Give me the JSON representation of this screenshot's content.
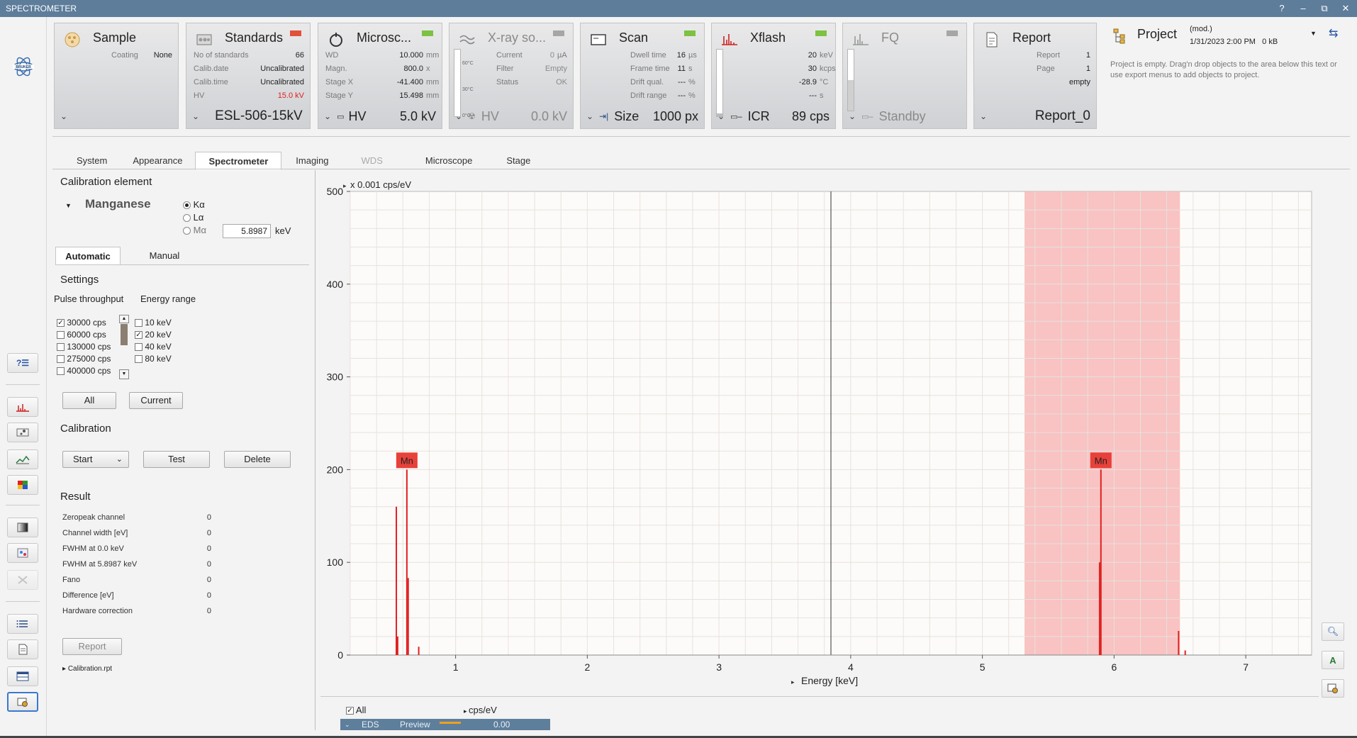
{
  "window": {
    "title": "SPECTROMETER",
    "controls": [
      "?",
      "–",
      "⧉",
      "✕"
    ]
  },
  "tiles": {
    "sample": {
      "name": "Sample",
      "rows": [
        {
          "k": "Coating",
          "v": "None",
          "u": ""
        }
      ]
    },
    "standards": {
      "name": "Standards",
      "rows": [
        {
          "k": "No of standards",
          "v": "66",
          "u": ""
        },
        {
          "k": "Calib.date",
          "v": "Uncalibrated",
          "u": ""
        },
        {
          "k": "Calib.time",
          "v": "Uncalibrated",
          "u": ""
        },
        {
          "k": "HV",
          "v": "15.0 kV",
          "u": ""
        }
      ],
      "footer": "ESL-506-15kV",
      "indicator": "#e0523a",
      "hv_color": "#e02020"
    },
    "microscope": {
      "name": "Microsc...",
      "rows": [
        {
          "k": "WD",
          "v": "10.000",
          "u": "mm"
        },
        {
          "k": "Magn.",
          "v": "800.0",
          "u": "x"
        },
        {
          "k": "Stage X",
          "v": "-41.400",
          "u": "mm"
        },
        {
          "k": "Stage Y",
          "v": "15.498",
          "u": "mm"
        }
      ],
      "footer_label": "HV",
      "footer_value": "5.0 kV",
      "indicator": "#7dc242"
    },
    "xray": {
      "name": "X-ray so...",
      "rows": [
        {
          "k": "Current",
          "v": "0",
          "u": "µA"
        },
        {
          "k": "Filter",
          "v": "Empty",
          "u": ""
        },
        {
          "k": "Status",
          "v": "OK",
          "u": ""
        }
      ],
      "scale": [
        "60°C",
        "30°C",
        "0°C"
      ],
      "footer_label": "HV",
      "footer_value": "0.0 kV",
      "indicator": "#a6a6a6"
    },
    "scan": {
      "name": "Scan",
      "rows": [
        {
          "k": "Dwell time",
          "v": "16",
          "u": "µs"
        },
        {
          "k": "Frame time",
          "v": "11",
          "u": "s"
        },
        {
          "k": "Drift qual.",
          "v": "---",
          "u": "%"
        },
        {
          "k": "Drift range",
          "v": "---",
          "u": "%"
        }
      ],
      "footer_label": "Size",
      "footer_value": "1000 px",
      "indicator": "#7dc242"
    },
    "xflash": {
      "name": "Xflash",
      "rows": [
        {
          "k": "",
          "v": "20",
          "u": "keV"
        },
        {
          "k": "",
          "v": "30",
          "u": "kcps"
        },
        {
          "k": "",
          "v": "-28.9",
          "u": "°C"
        },
        {
          "k": "",
          "v": "---",
          "u": "s"
        }
      ],
      "footer_label": "ICR",
      "footer_value": "89 cps",
      "indicator": "#7dc242"
    },
    "fq": {
      "name": "FQ",
      "footer_label": "Standby",
      "indicator": "#a6a6a6"
    },
    "report": {
      "name": "Report",
      "rows": [
        {
          "k": "Report",
          "v": "1",
          "u": ""
        },
        {
          "k": "Page",
          "v": "1",
          "u": ""
        },
        {
          "k": "",
          "v": "empty",
          "u": ""
        }
      ],
      "footer": "Report_0"
    }
  },
  "project": {
    "title": "Project",
    "status": "(mod.)",
    "datetime": "1/31/2023 2:00 PM",
    "size": "0 kB",
    "description": "Project is empty. Drag'n drop objects to the area below this text or use export menus to add objects to project."
  },
  "tabs": [
    {
      "label": "System",
      "active": false,
      "enabled": true
    },
    {
      "label": "Appearance",
      "active": false,
      "enabled": true
    },
    {
      "label": "Spectrometer",
      "active": true,
      "enabled": true
    },
    {
      "label": "Imaging",
      "active": false,
      "enabled": true
    },
    {
      "label": "WDS",
      "active": false,
      "enabled": false
    },
    {
      "label": "Microscope",
      "active": false,
      "enabled": true
    },
    {
      "label": "Stage",
      "active": false,
      "enabled": true
    }
  ],
  "calibration_element": {
    "title": "Calibration element",
    "element": "Manganese",
    "lines": [
      {
        "label": "Kα",
        "selected": true
      },
      {
        "label": "Lα",
        "selected": false
      },
      {
        "label": "Mα",
        "selected": false
      }
    ],
    "energy_value": "5.8987",
    "energy_unit": "keV"
  },
  "subtabs": [
    {
      "label": "Automatic",
      "active": true
    },
    {
      "label": "Manual",
      "active": false
    }
  ],
  "settings": {
    "title": "Settings",
    "pulse_label": "Pulse throughput",
    "energy_label": "Energy range",
    "pulse_options": [
      {
        "label": "30000 cps",
        "checked": true
      },
      {
        "label": "60000 cps",
        "checked": false
      },
      {
        "label": "130000 cps",
        "checked": false
      },
      {
        "label": "275000 cps",
        "checked": false
      },
      {
        "label": "400000 cps",
        "checked": false
      }
    ],
    "energy_options": [
      {
        "label": "10 keV",
        "checked": false
      },
      {
        "label": "20 keV",
        "checked": true
      },
      {
        "label": "40 keV",
        "checked": false
      },
      {
        "label": "80 keV",
        "checked": false
      }
    ],
    "all_button": "All",
    "current_button": "Current"
  },
  "calibration": {
    "title": "Calibration",
    "start_button": "Start",
    "test_button": "Test",
    "delete_button": "Delete"
  },
  "result": {
    "title": "Result",
    "rows": [
      {
        "label": "Zeropeak channel",
        "value": "0"
      },
      {
        "label": "Channel width [eV]",
        "value": "0"
      },
      {
        "label": "FWHM at 0.0 keV",
        "value": "0"
      },
      {
        "label": "FWHM at 5.8987 keV",
        "value": "0"
      },
      {
        "label": "Fano",
        "value": "0"
      },
      {
        "label": "Difference [eV]",
        "value": "0"
      },
      {
        "label": "Hardware correction",
        "value": "0"
      }
    ],
    "report_button": "Report",
    "report_file": "Calibration.rpt"
  },
  "chart_data": {
    "type": "line",
    "ylabel": "x 0.001 cps/eV",
    "xlabel": "Energy [keV]",
    "xlim": [
      0.2,
      7.5
    ],
    "ylim": [
      0,
      500
    ],
    "xticks": [
      1,
      2,
      3,
      4,
      5,
      6,
      7
    ],
    "yticks": [
      0,
      100,
      200,
      300,
      400,
      500
    ],
    "grid": true,
    "cursor_x": 3.85,
    "highlight_range": [
      5.32,
      6.5
    ],
    "highlight_color": "#f7b9b9",
    "series_color": "#e02020",
    "peaks": [
      {
        "x": 0.55,
        "y": 160
      },
      {
        "x": 0.56,
        "y": 20
      },
      {
        "x": 0.63,
        "y": 200
      },
      {
        "x": 0.64,
        "y": 83
      },
      {
        "x": 0.72,
        "y": 9
      },
      {
        "x": 5.89,
        "y": 100
      },
      {
        "x": 5.9,
        "y": 200
      },
      {
        "x": 6.49,
        "y": 26
      },
      {
        "x": 6.54,
        "y": 5
      }
    ],
    "markers": [
      {
        "label": "Mn",
        "x": 0.63,
        "y": 210
      },
      {
        "label": "Mn",
        "x": 5.9,
        "y": 210
      }
    ]
  },
  "spectrum_list": {
    "all_label": "All",
    "all_checked": true,
    "unit_label": "cps/eV",
    "row_name": "EDS",
    "row_mode": "Preview",
    "row_value": "0.00"
  }
}
